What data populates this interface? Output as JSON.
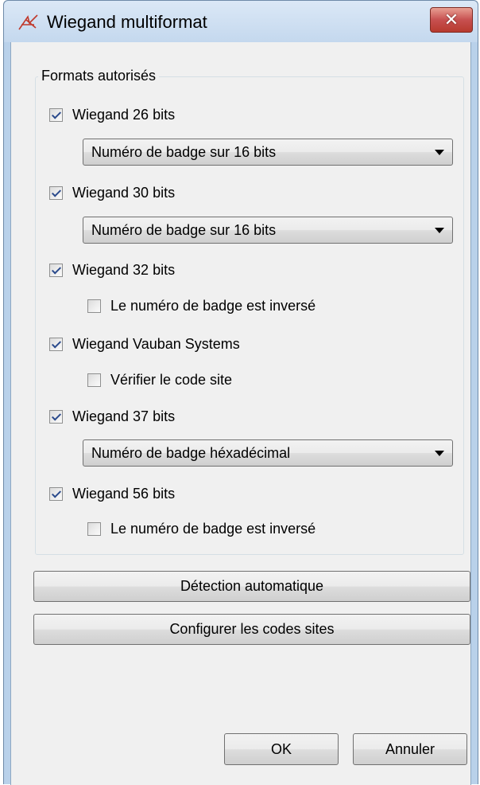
{
  "window": {
    "title": "Wiegand multiformat",
    "close_label": "✕"
  },
  "group": {
    "legend": "Formats autorisés",
    "formats": [
      {
        "label": "Wiegand 26 bits",
        "checked": true
      },
      {
        "label": "Wiegand 30 bits",
        "checked": true
      },
      {
        "label": "Wiegand 32 bits",
        "checked": true
      },
      {
        "label": "Wiegand Vauban Systems",
        "checked": true
      },
      {
        "label": "Wiegand 37 bits",
        "checked": true
      },
      {
        "label": "Wiegand 56 bits",
        "checked": true
      }
    ],
    "combos": {
      "w26": "Numéro de badge sur 16 bits",
      "w30": "Numéro de badge sur 16 bits",
      "w37": "Numéro de badge héxadécimal"
    },
    "suboptions": {
      "w32_reverse": {
        "label": "Le numéro de badge est inversé",
        "checked": false
      },
      "vauban_site": {
        "label": "Vérifier le code site",
        "checked": false
      },
      "w56_reverse": {
        "label": "Le numéro de badge est inversé",
        "checked": false
      }
    }
  },
  "buttons": {
    "auto_detect": "Détection automatique",
    "configure_sites": "Configurer les codes sites",
    "ok": "OK",
    "cancel": "Annuler"
  },
  "colors": {
    "titlebar": "#c4d8ee",
    "close": "#c75050",
    "client": "#f0f0f0"
  }
}
